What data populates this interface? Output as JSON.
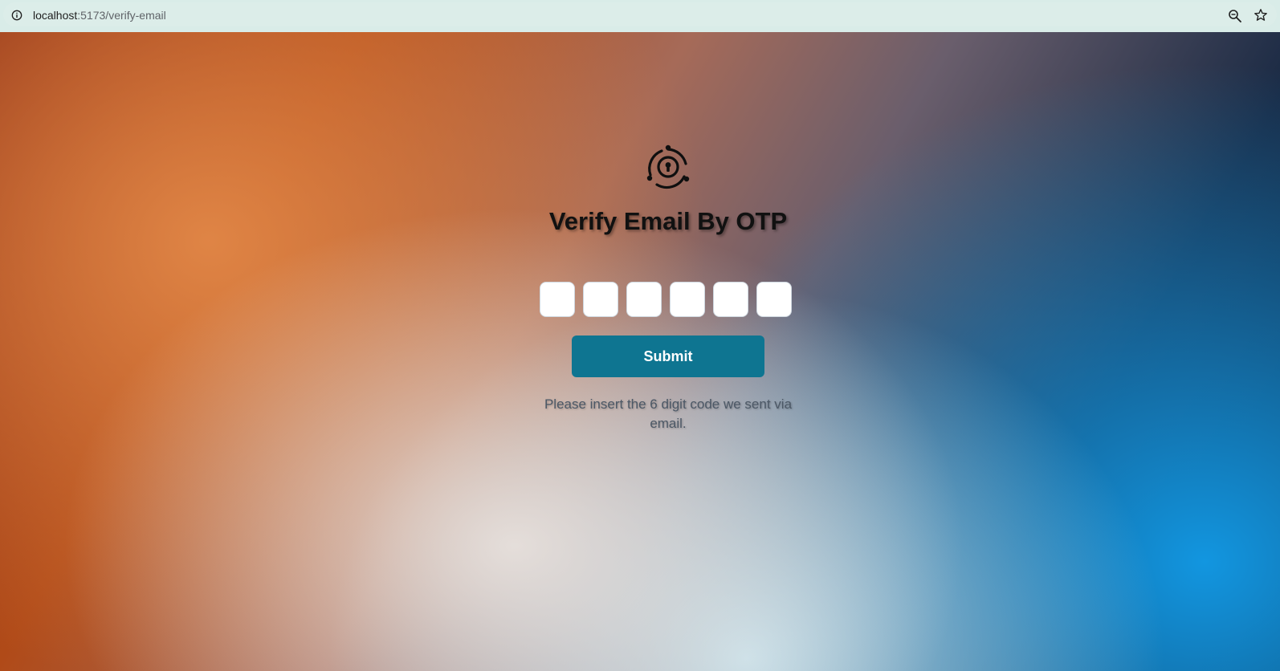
{
  "browser": {
    "url_host": "localhost",
    "url_path": ":5173/verify-email",
    "icons": [
      "info-icon",
      "zoom-icon",
      "star-icon"
    ]
  },
  "page": {
    "logo_icon": "lock-orbit-icon",
    "title": "Verify Email By OTP",
    "otp": {
      "digit_count": 6,
      "values": [
        "",
        "",
        "",
        "",
        "",
        ""
      ]
    },
    "submit_label": "Submit",
    "hint": "Please insert the 6 digit code we sent via email."
  },
  "colors": {
    "submit_button": "#0e7591",
    "otp_box": "#ffffff",
    "hint_text": "#4c5866"
  }
}
